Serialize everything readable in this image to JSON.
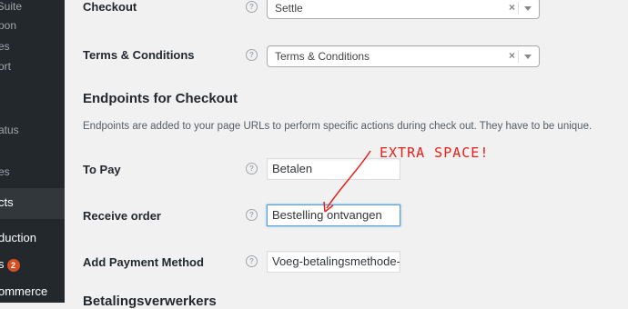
{
  "sidebar": {
    "items": [
      {
        "label": "t Suite"
      },
      {
        "label": "pon"
      },
      {
        "label": "es"
      },
      {
        "label": "ort"
      },
      {
        "label": "atus"
      },
      {
        "label": "es"
      },
      {
        "label": "cts"
      },
      {
        "label": "duction"
      },
      {
        "label": "s",
        "badge": "2"
      },
      {
        "label": "ommerce"
      }
    ]
  },
  "settings": {
    "checkout": {
      "label": "Checkout",
      "value": "Settle",
      "clear": "×"
    },
    "terms": {
      "label": "Terms & Conditions",
      "value": "Terms & Conditions",
      "clear": "×"
    },
    "help_icon": "?"
  },
  "endpoints": {
    "title": "Endpoints for Checkout",
    "description": "Endpoints are added to your page URLs to perform specific actions during check out. They have to be unique.",
    "fields": [
      {
        "label": "To Pay",
        "value": "Betalen"
      },
      {
        "label": "Receive order",
        "value": "Bestelling ontvangen"
      },
      {
        "label": "Add Payment Method",
        "value": "Voeg-betalingsmethode-"
      }
    ]
  },
  "annotation": {
    "text": "EXTRA SPACE!",
    "color": "#e8201a"
  },
  "next_section": {
    "title": "Betalingsverwerkers"
  },
  "colors": {
    "sidebar_bg": "#23282d",
    "page_bg": "#f1f1f1",
    "badge": "#d54e21",
    "focus": "#5b9dd9"
  }
}
